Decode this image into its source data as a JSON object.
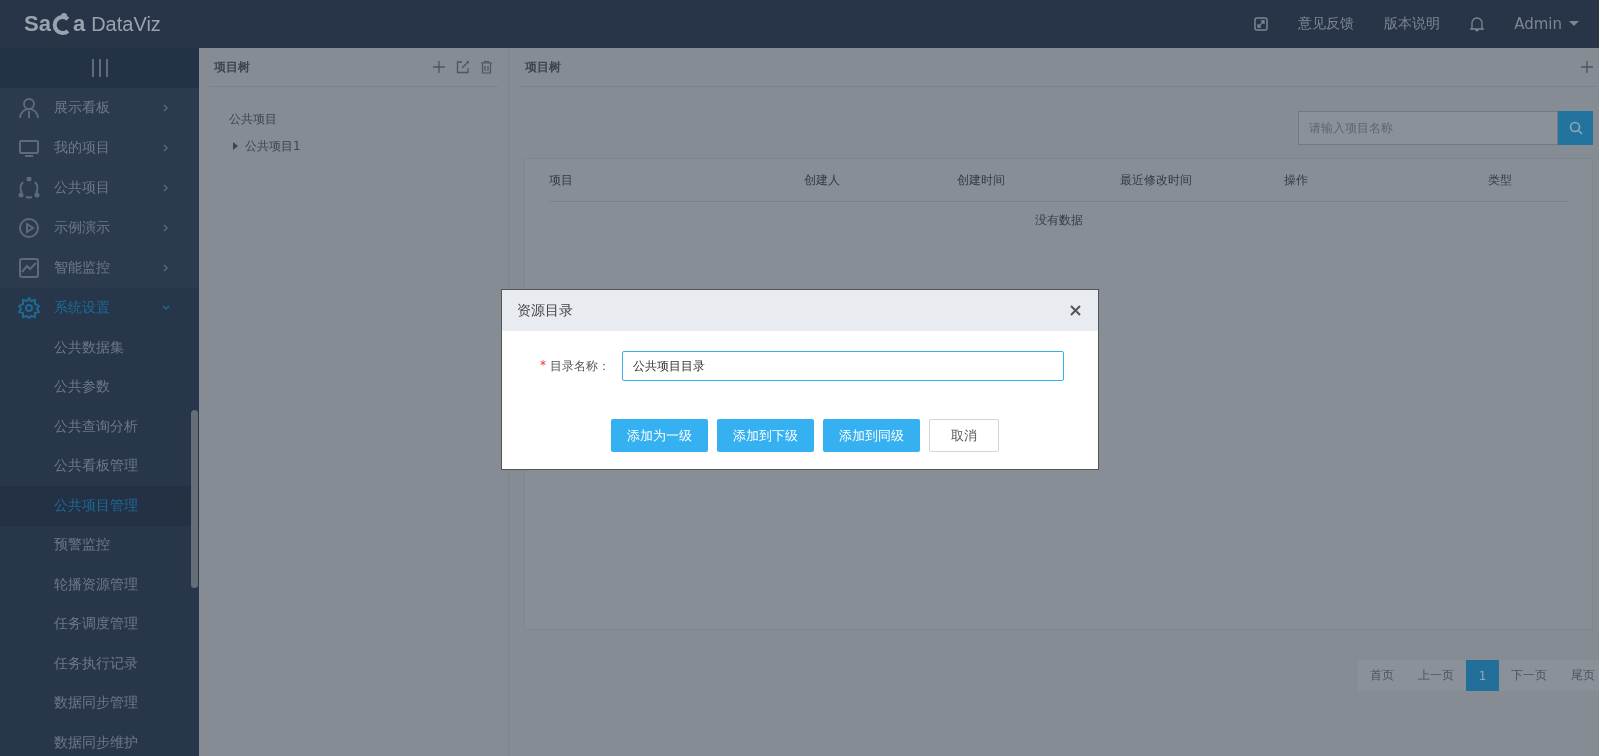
{
  "header": {
    "logo": {
      "part_1": "Sa",
      "part_2": "a",
      "product": "DataViz"
    },
    "links": [
      "意见反馈",
      "版本说明"
    ],
    "user": "Admin"
  },
  "sidebar": {
    "items": [
      {
        "label": "展示看板",
        "expanded": false,
        "selected": false
      },
      {
        "label": "我的项目",
        "expanded": false,
        "selected": false
      },
      {
        "label": "公共项目",
        "expanded": false,
        "selected": false
      },
      {
        "label": "示例演示",
        "expanded": false,
        "selected": false
      },
      {
        "label": "智能监控",
        "expanded": false,
        "selected": false
      },
      {
        "label": "系统设置",
        "expanded": true,
        "selected": true,
        "children": [
          {
            "label": "公共数据集",
            "selected": false
          },
          {
            "label": "公共参数",
            "selected": false
          },
          {
            "label": "公共查询分析",
            "selected": false
          },
          {
            "label": "公共看板管理",
            "selected": false
          },
          {
            "label": "公共项目管理",
            "selected": true
          },
          {
            "label": "预警监控",
            "selected": false
          },
          {
            "label": "轮播资源管理",
            "selected": false
          },
          {
            "label": "任务调度管理",
            "selected": false
          },
          {
            "label": "任务执行记录",
            "selected": false
          },
          {
            "label": "数据同步管理",
            "selected": false
          },
          {
            "label": "数据同步维护",
            "selected": false
          }
        ]
      }
    ]
  },
  "tree_panel": {
    "title": "项目树",
    "root": "公共项目",
    "nodes": [
      {
        "label": "公共项目1",
        "expanded": false
      }
    ]
  },
  "list_panel": {
    "title": "项目树",
    "search": {
      "placeholder": "请输入项目名称"
    },
    "table": {
      "columns": [
        "项目",
        "创建人",
        "创建时间",
        "最近修改时间",
        "操作",
        "类型"
      ],
      "empty_text": "没有数据"
    },
    "pagination": [
      {
        "label": "首页",
        "selected": false
      },
      {
        "label": "上一页",
        "selected": false
      },
      {
        "label": "1",
        "selected": true
      },
      {
        "label": "下一页",
        "selected": false
      },
      {
        "label": "尾页",
        "selected": false
      }
    ]
  },
  "dialog": {
    "title": "资源目录",
    "field": {
      "required_mark": "*",
      "label": "目录名称：",
      "value": "公共项目目录"
    },
    "buttons": [
      {
        "label": "添加为一级",
        "kind": "primary"
      },
      {
        "label": "添加到下级",
        "kind": "primary"
      },
      {
        "label": "添加到同级",
        "kind": "primary"
      },
      {
        "label": "取消",
        "kind": "default"
      }
    ]
  }
}
